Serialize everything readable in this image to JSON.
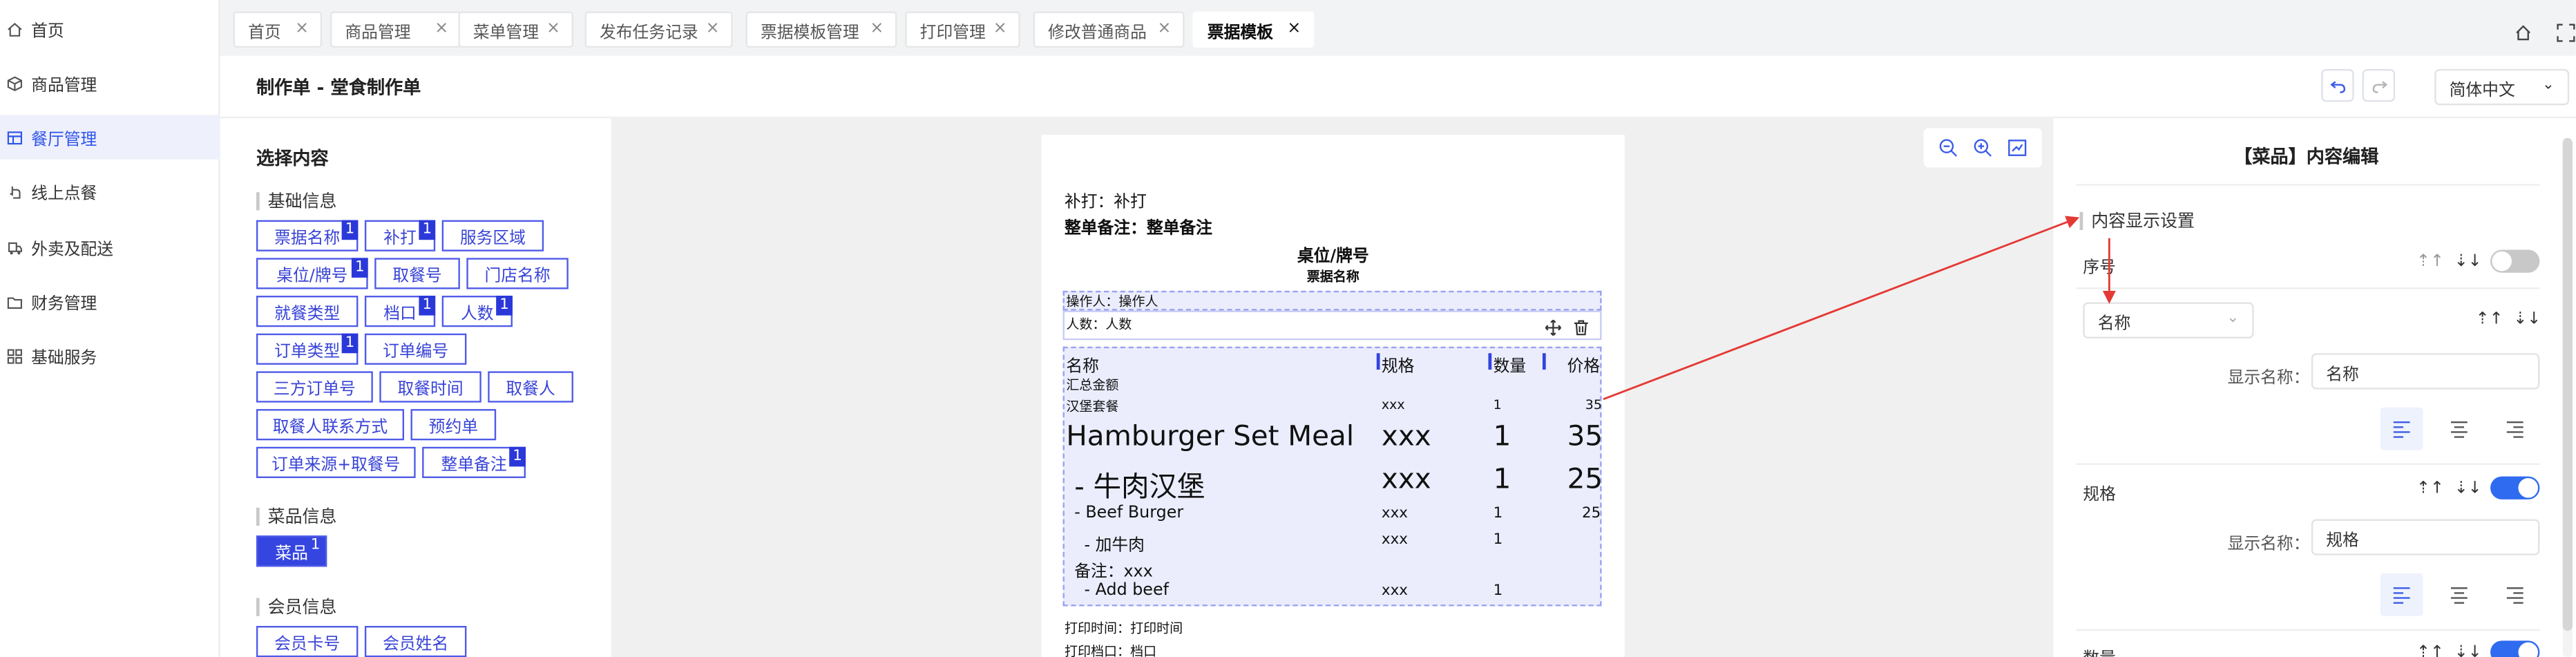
{
  "colors": {
    "accent": "#2f54eb",
    "tag_border": "#4f5be8",
    "badge": "#2b38d9",
    "arrow": "#e53935",
    "toggle_on": "#2f6bf0"
  },
  "sidebar": {
    "items": [
      {
        "label": "首页",
        "icon": "home-icon"
      },
      {
        "label": "商品管理",
        "icon": "cube-icon"
      },
      {
        "label": "餐厅管理",
        "icon": "layout-icon",
        "active": true
      },
      {
        "label": "线上点餐",
        "icon": "pointer-icon"
      },
      {
        "label": "外卖及配送",
        "icon": "delivery-icon"
      },
      {
        "label": "财务管理",
        "icon": "folder-icon"
      },
      {
        "label": "基础服务",
        "icon": "grid-icon"
      }
    ]
  },
  "tabs": [
    {
      "label": "首页",
      "close": "×"
    },
    {
      "label": "商品管理",
      "close": "×"
    },
    {
      "label": "菜单管理",
      "close": "×"
    },
    {
      "label": "发布任务记录",
      "close": "×"
    },
    {
      "label": "票据模板管理",
      "close": "×"
    },
    {
      "label": "打印管理",
      "close": "×"
    },
    {
      "label": "修改普通商品",
      "close": "×"
    },
    {
      "label": "票据模板",
      "close": "×",
      "active": true
    }
  ],
  "tabbar_icons": [
    "home-outline-icon",
    "fullscreen-icon"
  ],
  "header": {
    "title": "制作单 - 堂食制作单",
    "undo_icon": "undo-icon",
    "redo_icon": "redo-icon",
    "language": "简体中文",
    "language_chevron": "⌄"
  },
  "content_panel": {
    "title": "选择内容",
    "groups": [
      {
        "title": "基础信息",
        "tags": [
          {
            "label": "票据名称",
            "badge": "1"
          },
          {
            "label": "补打",
            "badge": "1"
          },
          {
            "label": "服务区域"
          },
          {
            "label": "桌位/牌号",
            "badge": "1"
          },
          {
            "label": "取餐号"
          },
          {
            "label": "门店名称"
          },
          {
            "label": "就餐类型"
          },
          {
            "label": "档口",
            "badge": "1"
          },
          {
            "label": "人数",
            "badge": "1"
          },
          {
            "label": "订单类型",
            "badge": "1"
          },
          {
            "label": "订单编号"
          },
          {
            "label": "三方订单号"
          },
          {
            "label": "取餐时间"
          },
          {
            "label": "取餐人"
          },
          {
            "label": "取餐人联系方式"
          },
          {
            "label": "预约单"
          },
          {
            "label": "订单来源+取餐号"
          },
          {
            "label": "整单备注",
            "badge": "1"
          }
        ]
      },
      {
        "title": "菜品信息",
        "tags": [
          {
            "label": "菜品",
            "badge": "1",
            "selected": true
          }
        ]
      },
      {
        "title": "会员信息",
        "tags": [
          {
            "label": "会员卡号"
          },
          {
            "label": "会员姓名"
          }
        ]
      }
    ]
  },
  "canvas": {
    "zoom_icons": [
      "zoom-out-icon",
      "zoom-in-icon",
      "fit-screen-icon"
    ],
    "receipt": {
      "reprint": "补打：补打",
      "order_remark": "整单备注：整单备注",
      "table_no": "桌位/牌号",
      "ticket_name": "票据名称",
      "operator": "操作人：操作人",
      "headcount": "人数：人数",
      "table_headers": [
        "名称",
        "规格",
        "数量",
        "价格"
      ],
      "summary": "汇总金额",
      "rows_small": [
        {
          "name": "汉堡套餐",
          "spec": "xxx",
          "qty": "1",
          "price": "35"
        }
      ],
      "rows_large": [
        {
          "name": "Hamburger Set Meal",
          "spec": "xxx",
          "qty": "1",
          "price": "35"
        },
        {
          "name": "- 牛肉汉堡",
          "spec": "xxx",
          "qty": "1",
          "price": "25"
        }
      ],
      "rows_medium": [
        {
          "name": "- Beef Burger",
          "spec": "xxx",
          "qty": "1",
          "price": "25"
        },
        {
          "name": "- 加牛肉",
          "spec": "xxx",
          "qty": "1",
          "price": ""
        }
      ],
      "remark": "备注：xxx",
      "addon": {
        "name": "- Add beef",
        "spec": "xxx",
        "qty": "1"
      },
      "print_time": "打印时间：打印时间",
      "print_station": "打印档口：档口"
    }
  },
  "right_panel": {
    "title": "【菜品】内容编辑",
    "section": "内容显示设置",
    "fields": [
      {
        "label": "序号",
        "enabled": false
      },
      {
        "select": "名称",
        "display_label": "显示名称：",
        "display_value": "名称"
      },
      {
        "label": "规格",
        "enabled": true,
        "display_label": "显示名称：",
        "display_value": "规格"
      },
      {
        "label": "数量",
        "enabled": true
      }
    ],
    "sort_up": "⇡↑",
    "sort_down": "⇣↓",
    "select_chevron": "⌄"
  }
}
